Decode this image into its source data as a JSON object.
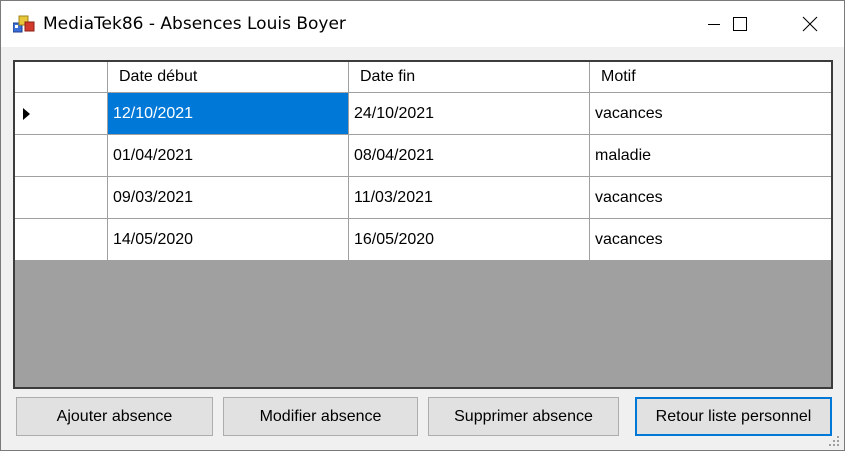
{
  "window": {
    "title": "MediaTek86 - Absences Louis Boyer"
  },
  "icons": {
    "app": "app-icon",
    "minimize": "minimize-icon",
    "maximize": "maximize-icon",
    "close": "close-icon",
    "current_row": "row-indicator-icon",
    "resize": "resize-grip-icon"
  },
  "colors": {
    "selection": "#0078d7",
    "empty_area": "#a0a0a0",
    "button_face": "#e1e1e1"
  },
  "grid": {
    "columns": [
      "Date début",
      "Date fin",
      "Motif"
    ],
    "rows": [
      {
        "date_debut": "12/10/2021",
        "date_fin": "24/10/2021",
        "motif": "vacances",
        "current": true
      },
      {
        "date_debut": "01/04/2021",
        "date_fin": "08/04/2021",
        "motif": "maladie"
      },
      {
        "date_debut": "09/03/2021",
        "date_fin": "11/03/2021",
        "motif": "vacances"
      },
      {
        "date_debut": "14/05/2020",
        "date_fin": "16/05/2020",
        "motif": "vacances"
      }
    ]
  },
  "buttons": {
    "add": "Ajouter absence",
    "edit": "Modifier absence",
    "delete": "Supprimer absence",
    "back": "Retour liste personnel"
  }
}
